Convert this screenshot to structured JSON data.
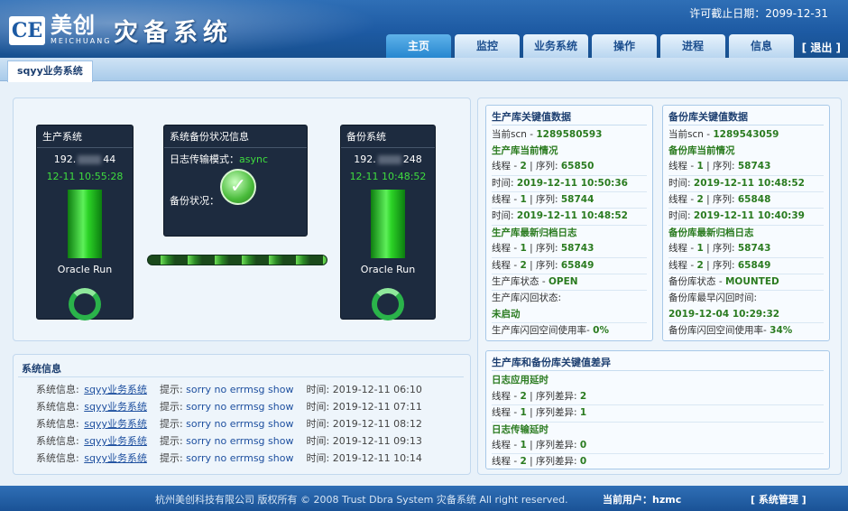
{
  "header": {
    "logo_mark": "CE",
    "logo_cn": "美创",
    "logo_en": "MEICHUANG",
    "system_title": "灾备系统",
    "license": "许可截止日期：2099-12-31",
    "nav": [
      "主页",
      "监控",
      "业务系统",
      "操作",
      "进程",
      "信息"
    ],
    "logout": "[ 退出 ]"
  },
  "subtab": "sqyy业务系统",
  "prod_box": {
    "title": "生产系统",
    "ip_prefix": "192.",
    "ip_suffix": "44",
    "time": "12-11 10:55:28",
    "status": "Oracle Run"
  },
  "backup_status": {
    "title": "系统备份状况信息",
    "mode_label": "日志传输模式：",
    "mode_value": "async",
    "status_label": "备份状况："
  },
  "backup_box": {
    "title": "备份系统",
    "ip_prefix": "192.",
    "ip_suffix": "248",
    "time": "12-11 10:48:52",
    "status": "Oracle Run"
  },
  "prod_key": {
    "title": "生产库关键值数据",
    "scn_label": "当前scn - ",
    "scn_value": "1289580593",
    "current_title": "生产库当前情况",
    "t1_thread": "线程 - ",
    "t1_thread_v": "2",
    "t1_seq": " | 序列: ",
    "t1_seq_v": "65850",
    "t1_time": "时间: ",
    "t1_time_v": "2019-12-11 10:50:36",
    "t2_thread": "线程 - ",
    "t2_thread_v": "1",
    "t2_seq": " | 序列: ",
    "t2_seq_v": "58744",
    "t2_time": "时间: ",
    "t2_time_v": "2019-12-11 10:48:52",
    "archive_title": "生产库最新归档日志",
    "a1": "线程 - ",
    "a1_v": "1",
    "a1_seq": " | 序列: ",
    "a1_seq_v": "58743",
    "a2": "线程 - ",
    "a2_v": "2",
    "a2_seq": " | 序列: ",
    "a2_seq_v": "65849",
    "state_label": "生产库状态 - ",
    "state_value": "OPEN",
    "flash_label": "生产库闪回状态:",
    "flash_value": "未启动",
    "space_label": "生产库闪回空间使用率- ",
    "space_value": "0%"
  },
  "backup_key": {
    "title": "备份库关键值数据",
    "scn_label": "当前scn - ",
    "scn_value": "1289543059",
    "current_title": "备份库当前情况",
    "t1_thread": "线程 - ",
    "t1_thread_v": "1",
    "t1_seq": " | 序列: ",
    "t1_seq_v": "58743",
    "t1_time": "时间: ",
    "t1_time_v": "2019-12-11 10:48:52",
    "t2_thread": "线程 - ",
    "t2_thread_v": "2",
    "t2_seq": " | 序列: ",
    "t2_seq_v": "65848",
    "t2_time": "时间: ",
    "t2_time_v": "2019-12-11 10:40:39",
    "archive_title": "备份库最新归档日志",
    "a1": "线程 - ",
    "a1_v": "1",
    "a1_seq": " | 序列: ",
    "a1_seq_v": "58743",
    "a2": "线程 - ",
    "a2_v": "2",
    "a2_seq": " | 序列: ",
    "a2_seq_v": "65849",
    "state_label": "备份库状态 - ",
    "state_value": "MOUNTED",
    "flash_label": "备份库最早闪回时间:",
    "flash_value": "2019-12-04 10:29:32",
    "space_label": "备份库闪回空间使用率- ",
    "space_value": "34%"
  },
  "diff": {
    "title": "生产库和备份库关键值差异",
    "apply_title": "日志应用延时",
    "apply1": "线程 - ",
    "apply1_v": "2",
    "apply1_diff": " | 序列差异: ",
    "apply1_diff_v": "2",
    "apply2": "线程 - ",
    "apply2_v": "1",
    "apply2_diff": " | 序列差异: ",
    "apply2_diff_v": "1",
    "trans_title": "日志传输延时",
    "trans1": "线程 - ",
    "trans1_v": "1",
    "trans1_diff": " | 序列差异: ",
    "trans1_diff_v": "0",
    "trans2": "线程 - ",
    "trans2_v": "2",
    "trans2_diff": " | 序列差异: ",
    "trans2_diff_v": "0"
  },
  "sysinfo": {
    "title": "系统信息",
    "rows": [
      {
        "label": "系统信息:",
        "link": "sqyy业务系统",
        "tip": "提示:",
        "msg": "sorry no errmsg show",
        "time_label": "时间:",
        "time": "2019-12-11 06:10"
      },
      {
        "label": "系统信息:",
        "link": "sqyy业务系统",
        "tip": "提示:",
        "msg": "sorry no errmsg show",
        "time_label": "时间:",
        "time": "2019-12-11 07:11"
      },
      {
        "label": "系统信息:",
        "link": "sqyy业务系统",
        "tip": "提示:",
        "msg": "sorry no errmsg show",
        "time_label": "时间:",
        "time": "2019-12-11 08:12"
      },
      {
        "label": "系统信息:",
        "link": "sqyy业务系统",
        "tip": "提示:",
        "msg": "sorry no errmsg show",
        "time_label": "时间:",
        "time": "2019-12-11 09:13"
      },
      {
        "label": "系统信息:",
        "link": "sqyy业务系统",
        "tip": "提示:",
        "msg": "sorry no errmsg show",
        "time_label": "时间:",
        "time": "2019-12-11 10:14"
      }
    ]
  },
  "footer": {
    "copyright": "杭州美创科技有限公司 版权所有 © 2008 Trust Dbra System 灾备系统 All right reserved.",
    "user": "当前用户：hzmc",
    "admin": "[ 系统管理 ]"
  }
}
